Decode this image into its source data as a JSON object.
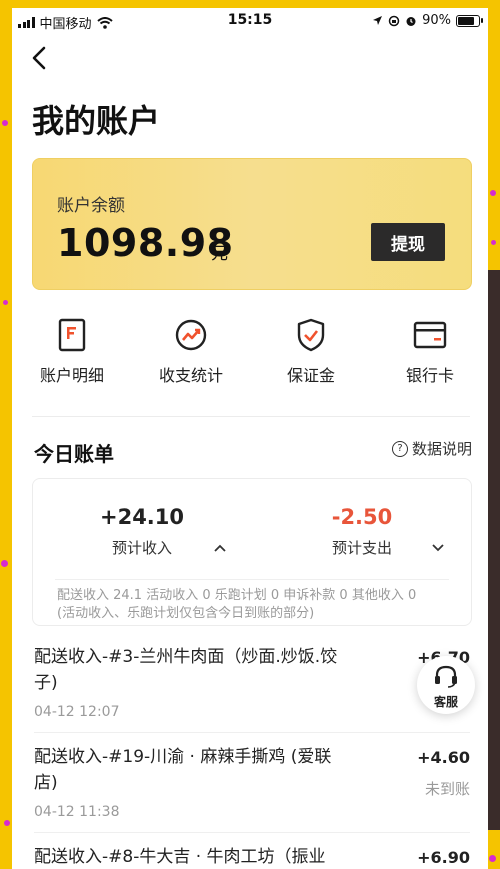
{
  "status_bar": {
    "carrier": "中国移动",
    "time": "15:15",
    "battery": "90%",
    "battery_level": 0.9
  },
  "header": {
    "title": "我的账户"
  },
  "balance": {
    "label": "账户余额",
    "amount": "1098.98",
    "unit": "元",
    "withdraw_label": "提现"
  },
  "shortcuts": [
    {
      "label": "账户明细",
      "icon": "document-icon"
    },
    {
      "label": "收支统计",
      "icon": "trend-chart-icon"
    },
    {
      "label": "保证金",
      "icon": "shield-check-icon"
    },
    {
      "label": "银行卡",
      "icon": "bank-card-icon"
    }
  ],
  "today": {
    "title": "今日账单",
    "explain_label": "数据说明",
    "income": {
      "value": "+24.10",
      "label": "预计收入"
    },
    "expense": {
      "value": "-2.50",
      "label": "预计支出"
    },
    "note_line1": "配送收入 24.1 活动收入 0 乐跑计划 0 申诉补款 0 其他收入 0",
    "note_line2": "(活动收入、乐跑计划仅包含今日到账的部分)"
  },
  "records": [
    {
      "title": "配送收入-#3-兰州牛肉面（炒面.炒饭.饺子)",
      "time": "04-12 12:07",
      "amount": "+6.70",
      "status": ""
    },
    {
      "title": "配送收入-#19-川渝 · 麻辣手撕鸡 (爱联店)",
      "time": "04-12 11:38",
      "amount": "+4.60",
      "status": "未到账"
    },
    {
      "title": "配送收入-#8-牛大吉 · 牛肉工坊（振业",
      "time": "",
      "amount": "+6.90",
      "status": ""
    }
  ],
  "service": {
    "label": "客服"
  },
  "colors": {
    "accent": "#f5c400",
    "expense": "#e8553a",
    "withdraw_bg": "#2b2a2a"
  }
}
